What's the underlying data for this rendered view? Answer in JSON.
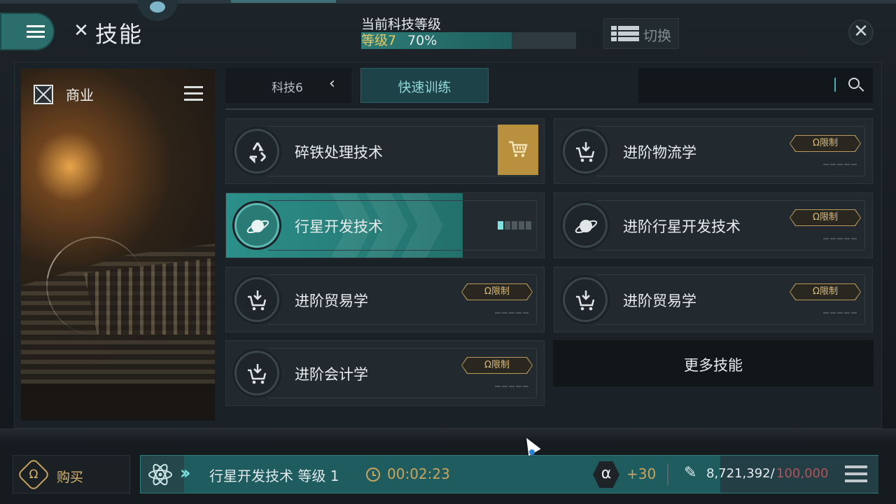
{
  "header": {
    "title": "技能",
    "tech_level_label": "当前科技等级",
    "tech_level_value": "等级7",
    "tech_progress_text": "70%",
    "tech_progress": 0.7,
    "switch_label": "切换"
  },
  "sidebar": {
    "category": "商业"
  },
  "tabs": {
    "tech_label": "科技6",
    "quick_train_label": "快速训练"
  },
  "search": {
    "placeholder": ""
  },
  "skills": [
    {
      "name": "碎铁处理技术",
      "icon": "recycle-icon",
      "state": "purchasable",
      "badge": ""
    },
    {
      "name": "进阶物流学",
      "icon": "cart-download-icon",
      "state": "locked",
      "badge": "Ω限制"
    },
    {
      "name": "行星开发技术",
      "icon": "planet-icon",
      "state": "training",
      "badge": ""
    },
    {
      "name": "进阶行星开发技术",
      "icon": "planet-icon",
      "state": "locked",
      "badge": "Ω限制"
    },
    {
      "name": "进阶贸易学",
      "icon": "cart-download-icon",
      "state": "locked",
      "badge": "Ω限制"
    },
    {
      "name": "进阶贸易学",
      "icon": "cart-download-icon",
      "state": "locked",
      "badge": "Ω限制"
    },
    {
      "name": "进阶会计学",
      "icon": "cart-download-icon",
      "state": "locked",
      "badge": "Ω限制"
    }
  ],
  "more_skills_label": "更多技能",
  "bottom": {
    "buy_label": "购买",
    "training_name": "行星开发技术 等级 1",
    "training_time": "00:02:23",
    "alpha_bonus": "+30",
    "sp_current": "8,721,392/",
    "sp_max": "100,000"
  },
  "colors": {
    "accent_teal": "#2c8f89",
    "gold": "#b8903e",
    "omega_badge": "#d8bc7e"
  }
}
